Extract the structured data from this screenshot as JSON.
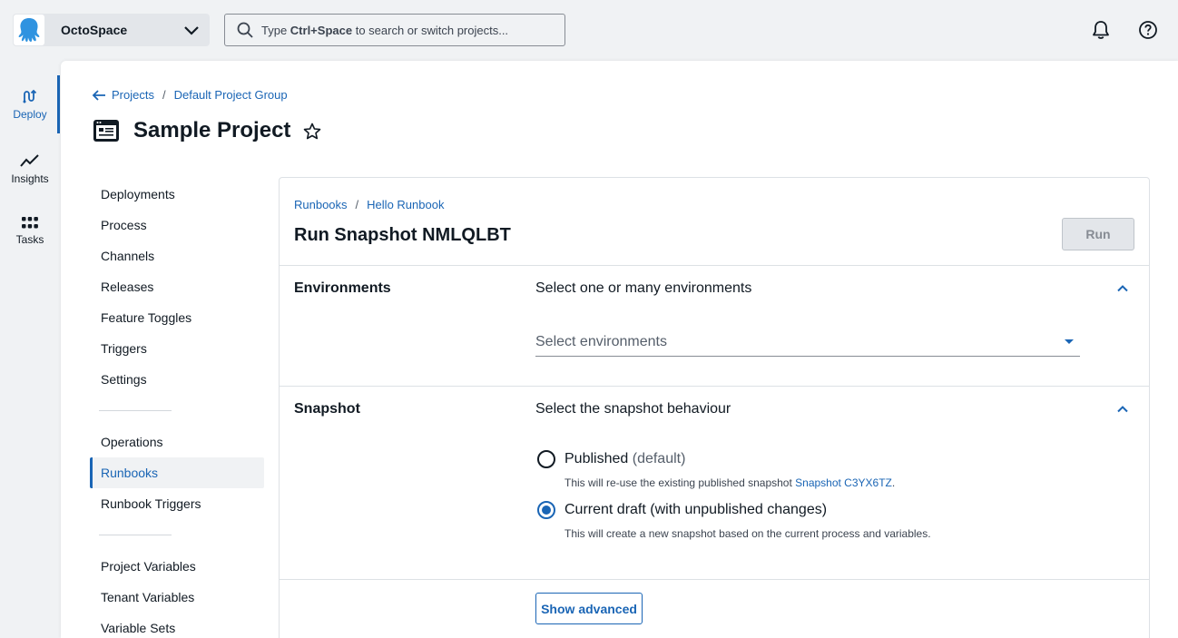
{
  "topbar": {
    "space_name": "OctoSpace",
    "search": {
      "prefix": "Type ",
      "shortcut": "Ctrl+Space",
      "suffix": " to search or switch projects..."
    }
  },
  "rail": {
    "items": [
      {
        "label": "Deploy",
        "icon": "deploy-icon",
        "active": true
      },
      {
        "label": "Insights",
        "icon": "insights-icon",
        "active": false
      },
      {
        "label": "Tasks",
        "icon": "tasks-icon",
        "active": false
      }
    ]
  },
  "breadcrumb": {
    "projects": "Projects",
    "sep": "/",
    "group": "Default Project Group"
  },
  "project": {
    "title": "Sample Project"
  },
  "nav": {
    "group1": [
      "Deployments",
      "Process",
      "Channels",
      "Releases",
      "Feature Toggles",
      "Triggers",
      "Settings"
    ],
    "group2": [
      "Operations",
      "Runbooks",
      "Runbook Triggers"
    ],
    "group3": [
      "Project Variables",
      "Tenant Variables",
      "Variable Sets"
    ],
    "active": "Runbooks"
  },
  "card": {
    "breadcrumb": {
      "runbooks": "Runbooks",
      "sep": "/",
      "runbook": "Hello Runbook"
    },
    "title": "Run Snapshot NMLQLBT",
    "run_label": "Run",
    "environments": {
      "title": "Environments",
      "desc": "Select one or many environments",
      "placeholder": "Select environments"
    },
    "snapshot": {
      "title": "Snapshot",
      "desc": "Select the snapshot behaviour",
      "options": [
        {
          "label": "Published",
          "suffix": "(default)",
          "note": "This will re-use the existing published snapshot ",
          "link": "Snapshot C3YX6TZ",
          "note_end": ".",
          "checked": false
        },
        {
          "label": "Current draft (with unpublished changes)",
          "note": "This will create a new snapshot based on the current process and variables.",
          "checked": true
        }
      ]
    },
    "show_advanced": "Show advanced"
  },
  "colors": {
    "accent": "#1a65b5",
    "text": "#111a23",
    "background": "#f0f2f4"
  }
}
